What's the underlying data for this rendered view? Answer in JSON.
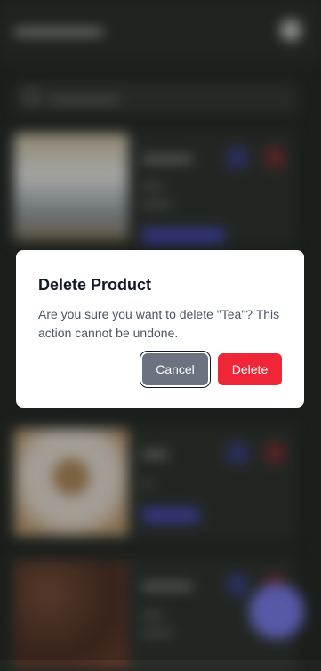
{
  "dialog": {
    "title": "Delete Product",
    "message": "Are you sure you want to delete \"Tea\"? This action cannot be undone.",
    "cancel_label": "Cancel",
    "delete_label": "Delete"
  },
  "colors": {
    "delete_button": "#ef2637",
    "cancel_button": "#6b7280",
    "fab": "#7b7cf5"
  }
}
